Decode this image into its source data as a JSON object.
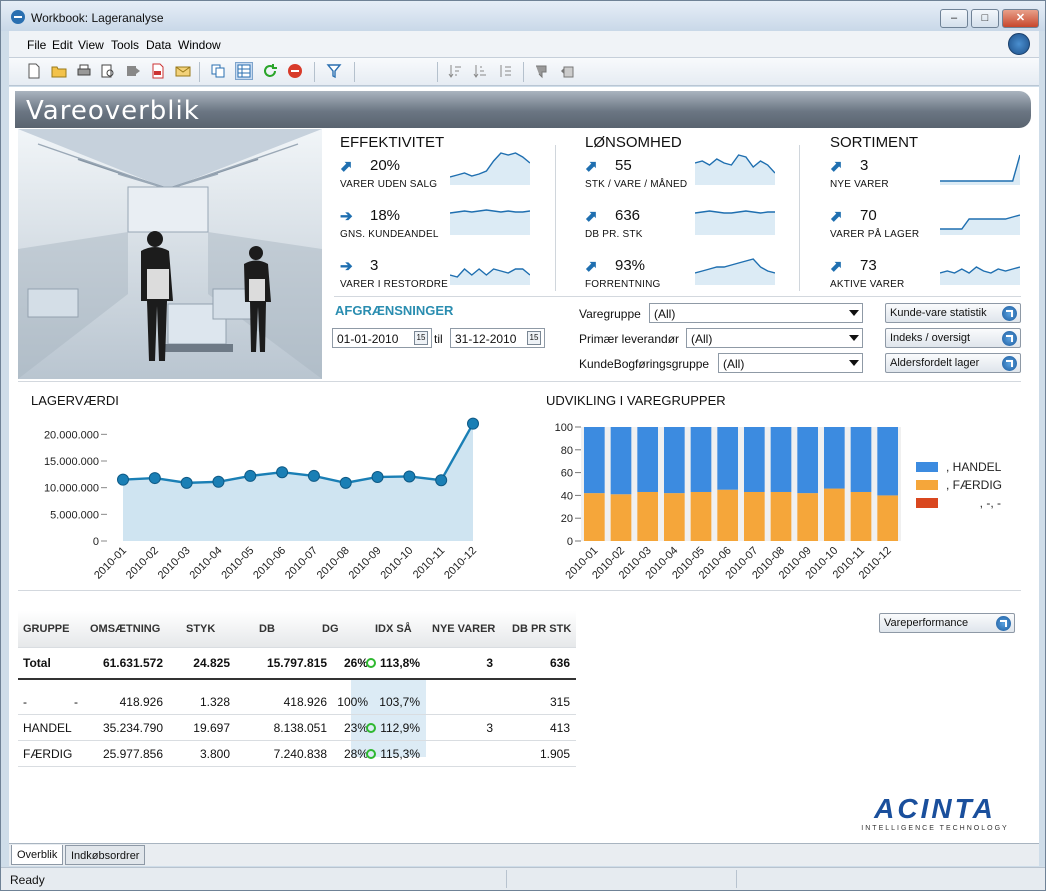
{
  "window": {
    "title": "Workbook: Lageranalyse"
  },
  "menu": [
    "File",
    "Edit",
    "View",
    "Tools",
    "Data",
    "Window"
  ],
  "page": {
    "title": "Vareoverblik"
  },
  "kpis": {
    "effektivitet": {
      "heading": "EFFEKTIVITET",
      "items": [
        {
          "value": "20%",
          "label": "VARER UDEN SALG",
          "arrow": "up"
        },
        {
          "value": "18%",
          "label": "GNS. KUNDEANDEL",
          "arrow": "right"
        },
        {
          "value": "3",
          "label": "VARER I RESTORDRE",
          "arrow": "right"
        }
      ]
    },
    "lonsomhed": {
      "heading": "LØNSOMHED",
      "items": [
        {
          "value": "55",
          "label": "STK / VARE / MÅNED",
          "arrow": "up"
        },
        {
          "value": "636",
          "label": "DB PR. STK",
          "arrow": "up"
        },
        {
          "value": "93%",
          "label": "FORRENTNING",
          "arrow": "up"
        }
      ]
    },
    "sortiment": {
      "heading": "SORTIMENT",
      "items": [
        {
          "value": "3",
          "label": "NYE VARER",
          "arrow": "up"
        },
        {
          "value": "70",
          "label": "VARER PÅ LAGER",
          "arrow": "up"
        },
        {
          "value": "73",
          "label": "AKTIVE VARER",
          "arrow": "up"
        }
      ]
    }
  },
  "filters": {
    "heading": "AFGRÆNSNINGER",
    "date_from": "01-01-2010",
    "date_sep": "til",
    "date_to": "31-12-2010",
    "varegruppe_label": "Varegruppe",
    "varegruppe_value": "(All)",
    "primaer_label": "Primær leverandør",
    "primaer_value": "(All)",
    "kunde_label": "KundeBogføringsgruppe",
    "kunde_value": "(All)"
  },
  "nav_buttons": {
    "kunde_vare": "Kunde-vare statistik",
    "indeks": "Indeks / oversigt",
    "alders": "Aldersfordelt lager",
    "vareperformance": "Vareperformance"
  },
  "chart_data": [
    {
      "type": "area",
      "title": "LAGERVÆRDI",
      "categories": [
        "2010-01",
        "2010-02",
        "2010-03",
        "2010-04",
        "2010-05",
        "2010-06",
        "2010-07",
        "2010-08",
        "2010-09",
        "2010-10",
        "2010-11",
        "2010-12"
      ],
      "values": [
        11500000,
        11800000,
        10900000,
        11100000,
        12200000,
        12900000,
        12200000,
        10900000,
        12000000,
        12100000,
        11400000,
        22000000
      ],
      "ylim": [
        0,
        22500000
      ],
      "yticks": [
        "0",
        "5.000.000",
        "10.000.000",
        "15.000.000",
        "20.000.000"
      ],
      "color": "#1a7fb5"
    },
    {
      "type": "bar",
      "stacked": true,
      "title": "UDVIKLING I VAREGRUPPER",
      "categories": [
        "2010-01",
        "2010-02",
        "2010-03",
        "2010-04",
        "2010-05",
        "2010-06",
        "2010-07",
        "2010-08",
        "2010-09",
        "2010-10",
        "2010-11",
        "2010-12"
      ],
      "series": [
        {
          "name": ", FÆRDIG",
          "color": "#f5a63a",
          "values": [
            42,
            41,
            43,
            42,
            43,
            45,
            43,
            43,
            42,
            46,
            43,
            40
          ]
        },
        {
          "name": ", HANDEL",
          "color": "#3c8be0",
          "values": [
            58,
            59,
            57,
            58,
            57,
            55,
            57,
            57,
            58,
            54,
            57,
            60
          ]
        },
        {
          "name": ", -, -",
          "color": "#d9471f",
          "values": [
            0,
            0,
            0,
            0,
            0,
            0,
            0,
            0,
            0,
            0,
            0,
            0
          ]
        }
      ],
      "legend_order": [
        ", HANDEL",
        ", FÆRDIG",
        ", -, -"
      ],
      "ylim": [
        0,
        100
      ],
      "yticks": [
        "0",
        "20",
        "40",
        "60",
        "80",
        "100"
      ]
    }
  ],
  "table": {
    "headers": [
      "GRUPPE",
      "OMSÆTNING",
      "STYK",
      "DB",
      "DG",
      "IDX SÅ",
      "NYE VARER",
      "DB PR STK"
    ],
    "total": {
      "gruppe": "Total",
      "oms": "61.631.572",
      "styk": "24.825",
      "db": "15.797.815",
      "dg": "26%",
      "idx": "113,8%",
      "nye": "3",
      "dbpr": "636"
    },
    "rows": [
      {
        "gruppe": "-",
        "sub": "-",
        "oms": "418.926",
        "styk": "1.328",
        "db": "418.926",
        "dg": "100%",
        "idx": "103,7%",
        "nye": "",
        "dbpr": "315"
      },
      {
        "gruppe": "HANDEL",
        "sub": "",
        "oms": "35.234.790",
        "styk": "19.697",
        "db": "8.138.051",
        "dg": "23%",
        "idx": "112,9%",
        "nye": "3",
        "dbpr": "413"
      },
      {
        "gruppe": "FÆRDIG",
        "sub": "",
        "oms": "25.977.856",
        "styk": "3.800",
        "db": "7.240.838",
        "dg": "28%",
        "idx": "115,3%",
        "nye": "",
        "dbpr": "1.905"
      }
    ]
  },
  "logo": {
    "name": "ACINTA",
    "tagline": "INTELLIGENCE TECHNOLOGY"
  },
  "tabs": [
    "Overblik",
    "Indkøbsordrer"
  ],
  "status": "Ready"
}
